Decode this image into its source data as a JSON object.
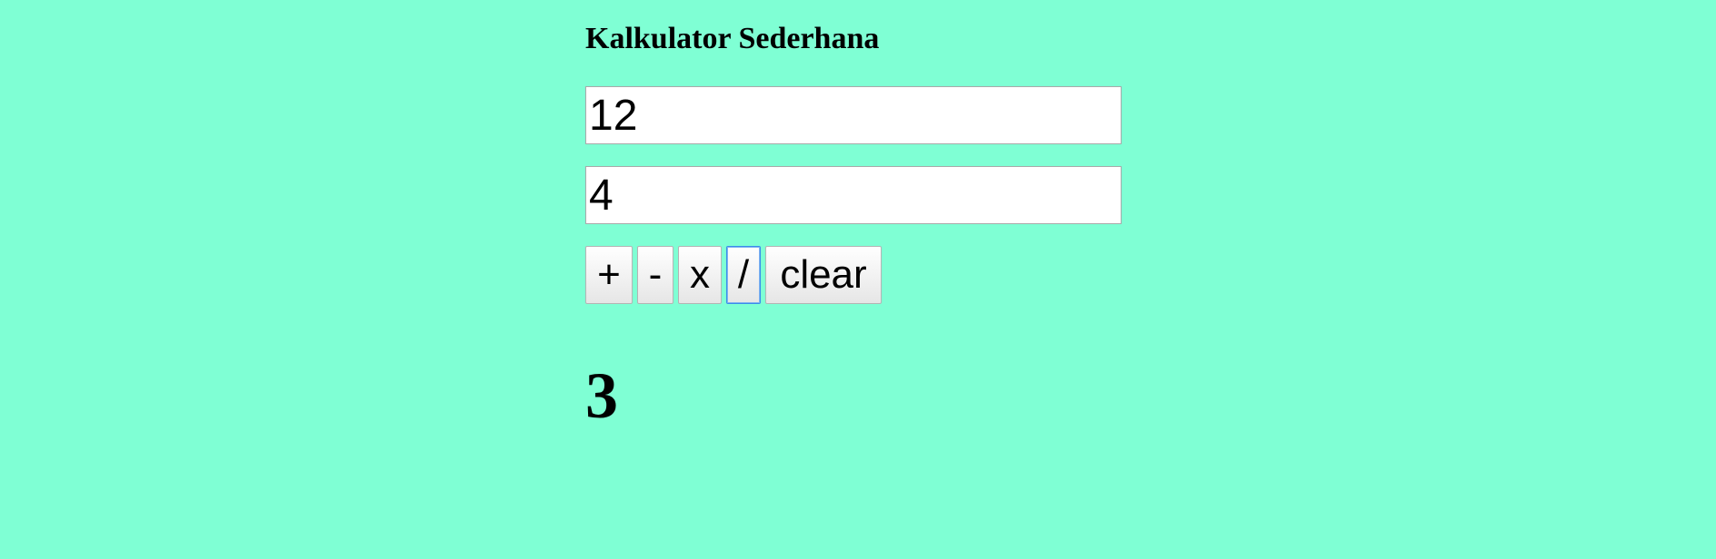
{
  "page": {
    "background_color": "#7fffd4"
  },
  "calculator": {
    "title": "Kalkulator Sederhana",
    "input_1_value": "12",
    "input_2_value": "4",
    "buttons": {
      "add_label": "+",
      "subtract_label": "-",
      "multiply_label": "x",
      "divide_label": "/",
      "clear_label": "clear"
    },
    "result": "3"
  }
}
